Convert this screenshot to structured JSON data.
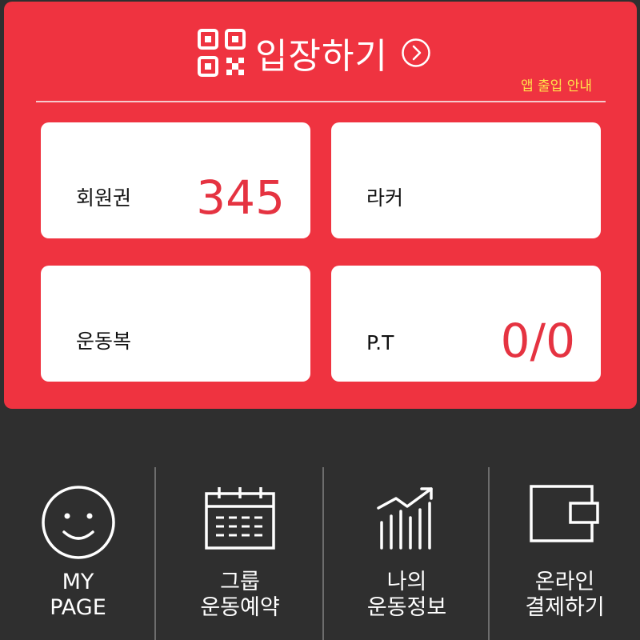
{
  "entry": {
    "title": "입장하기",
    "guide_link": "앱 출입 안내"
  },
  "cards": {
    "membership": {
      "label": "회원권",
      "value": "345"
    },
    "locker": {
      "label": "라커",
      "value": ""
    },
    "sportswear": {
      "label": "운동복",
      "value": ""
    },
    "pt": {
      "label": "P.T",
      "value": "0/0"
    }
  },
  "nav": {
    "items": [
      {
        "line1": "MY",
        "line2": "PAGE",
        "icon": "smiley-icon"
      },
      {
        "line1": "그룹",
        "line2": "운동예약",
        "icon": "calendar-icon"
      },
      {
        "line1": "나의",
        "line2": "운동정보",
        "icon": "growth-chart-icon"
      },
      {
        "line1": "온라인",
        "line2": "결제하기",
        "icon": "wallet-icon"
      }
    ]
  },
  "colors": {
    "panel_red": "#ef3340",
    "value_red": "#e53341",
    "guide_yellow": "#ffe24a",
    "nav_background": "#2f2f2f"
  }
}
